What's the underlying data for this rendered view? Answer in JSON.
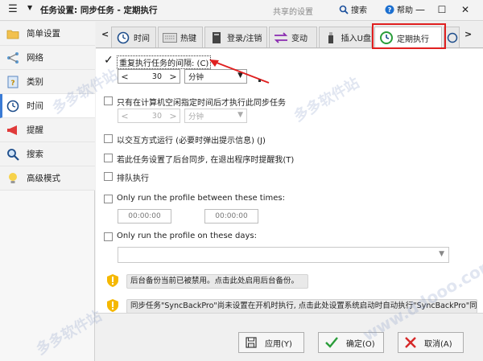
{
  "titlebar": {
    "title": "任务设置: 同步任务 - 定期执行",
    "shared_settings": "共享的设置",
    "search": "搜索",
    "help": "帮助"
  },
  "sidebar": {
    "items": [
      {
        "label": "简单设置",
        "icon": "folder-icon"
      },
      {
        "label": "网络",
        "icon": "network-icon"
      },
      {
        "label": "类别",
        "icon": "category-icon"
      },
      {
        "label": "时间",
        "icon": "clock-icon"
      },
      {
        "label": "提醒",
        "icon": "megaphone-icon"
      },
      {
        "label": "搜索",
        "icon": "magnifier-icon"
      },
      {
        "label": "高级模式",
        "icon": "lightbulb-icon"
      }
    ],
    "active_index": 3
  },
  "tabs": {
    "items": [
      {
        "label": "时间",
        "icon": "clock-icon"
      },
      {
        "label": "热键",
        "icon": "keyboard-icon"
      },
      {
        "label": "登录/注销",
        "icon": "computer-icon"
      },
      {
        "label": "变动",
        "icon": "change-icon"
      },
      {
        "label": "插入U盘",
        "icon": "usb-icon"
      },
      {
        "label": "定期执行",
        "icon": "refresh-clock-icon"
      }
    ],
    "active_index": 5
  },
  "content": {
    "repeat_interval": {
      "label": "重复执行任务的间隔: (C)",
      "checked": true,
      "value": "30",
      "unit": "分钟"
    },
    "idle_only": {
      "label": "只有在计算机空闲指定时间后才执行此同步任务",
      "checked": false,
      "value": "30",
      "unit": "分钟"
    },
    "interactive": {
      "label": "以交互方式运行 (必要时弹出提示信息) (J)",
      "checked": false
    },
    "background_sync": {
      "label": "若此任务设置了后台同步, 在退出程序时提醒我(T)",
      "checked": false
    },
    "queue": {
      "label": "排队执行",
      "checked": false
    },
    "between_times": {
      "label": "Only run the profile between these times:",
      "checked": false,
      "start": "00:00:00",
      "end": "00:00:00"
    },
    "on_days": {
      "label": "Only run the profile on these days:",
      "checked": false
    },
    "notice_backup": "后台备份当前已被禁用。点击此处启用后台备份。",
    "notice_startup": "同步任务\"SyncBackPro\"尚未设置在开机时执行, 点击此处设置系统启动时自动执行\"SyncBackPro\"同步任务"
  },
  "buttons": {
    "apply": "应用(Y)",
    "ok": "确定(O)",
    "cancel": "取消(A)"
  },
  "watermark": "多多软件站",
  "watermark_url": "www.ddooo.com",
  "colors": {
    "accent": "#3a7bd5",
    "highlight": "#e02020",
    "warning": "#f5b800",
    "ok_green": "#2a9d3a",
    "cancel_red": "#d62828"
  }
}
